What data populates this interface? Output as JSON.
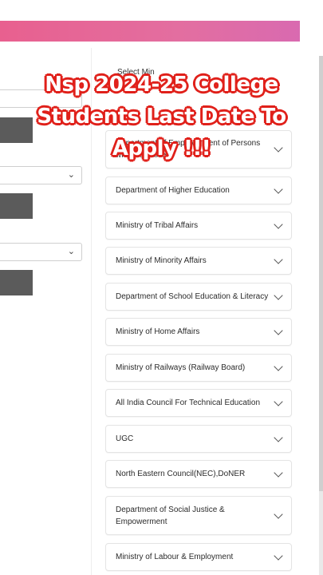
{
  "overlay": {
    "line1": "Nsp 2024-25 College",
    "line2": "Students Last Date To",
    "line3": "Apply !!!"
  },
  "hidden_label": "Select Min",
  "left_panel": {
    "select_chevron": "⌄"
  },
  "ministries": [
    {
      "label": "Department of Empowerment of Persons with Disabilities"
    },
    {
      "label": "Department of Higher Education"
    },
    {
      "label": "Ministry of Tribal Affairs"
    },
    {
      "label": "Ministry of Minority Affairs"
    },
    {
      "label": "Department of School Education & Literacy"
    },
    {
      "label": "Ministry of Home Affairs"
    },
    {
      "label": "Ministry of Railways (Railway Board)"
    },
    {
      "label": "All India Council For Technical Education"
    },
    {
      "label": "UGC"
    },
    {
      "label": "North Eastern Council(NEC),DoNER"
    },
    {
      "label": "Department of Social Justice & Empowerment"
    },
    {
      "label": "Ministry of Labour & Employment"
    }
  ],
  "colors": {
    "banner": "#e8608f",
    "overlay_outline": "#e0201a",
    "left_button": "#5b5b5b"
  }
}
